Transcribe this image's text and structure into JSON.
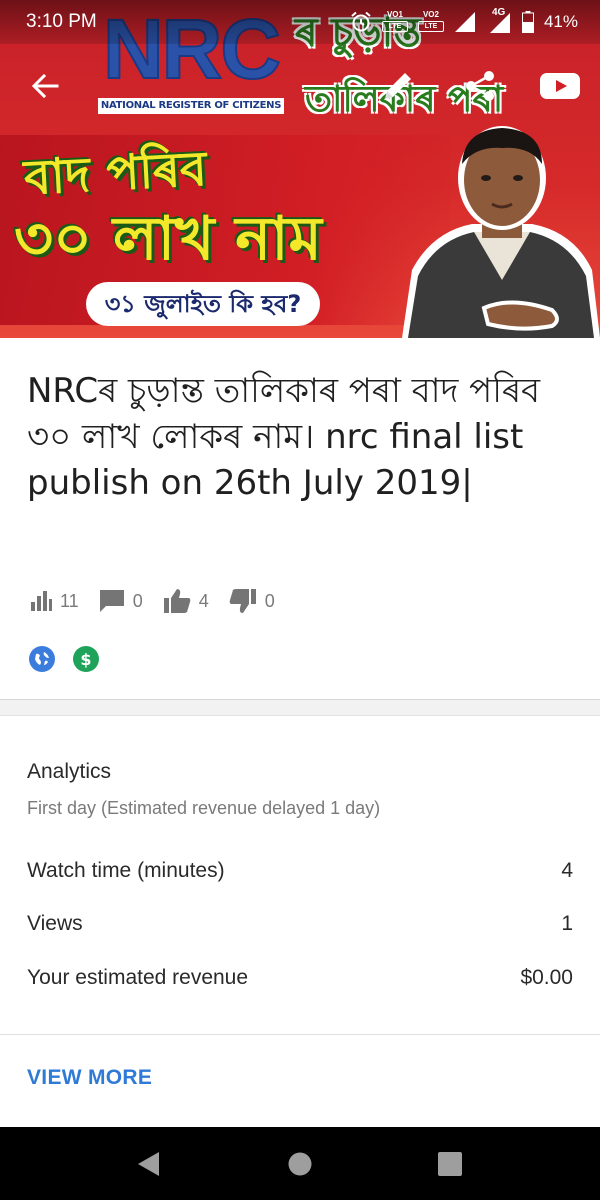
{
  "status_bar": {
    "time": "3:10 PM",
    "sim1_top": "VO",
    "sim1_num": "1",
    "sim1_box": "LTE",
    "sim2_top": "VO",
    "sim2_num": "2",
    "sim2_box": "LTE",
    "network": "4G",
    "battery": "41%"
  },
  "thumbnail": {
    "logo_text": "NRC",
    "logo_subtitle": "NATIONAL REGISTER OF CITIZENS",
    "headline_top": "ৰ চুড়ান্ত",
    "headline_mid": "তালিকাৰ পৰা",
    "big_line1": "বাদ পৰিব",
    "big_line2": "৩০ লাখ নাম",
    "question": "৩১ জুলাইত কি হব?"
  },
  "video": {
    "title": "NRCৰ চুড়ান্ত তালিকাৰ পৰা বাদ পৰিব ৩০ লাখ লোকৰ নাম। nrc final list publish on 26th July 2019|",
    "stats": {
      "views": "11",
      "comments": "0",
      "likes": "4",
      "dislikes": "0"
    }
  },
  "analytics": {
    "title": "Analytics",
    "subtitle": "First day (Estimated revenue delayed 1 day)",
    "metrics": [
      {
        "label": "Watch time (minutes)",
        "value": "4"
      },
      {
        "label": "Views",
        "value": "1"
      },
      {
        "label": "Your estimated revenue",
        "value": "$0.00"
      }
    ],
    "view_more": "VIEW MORE"
  },
  "colors": {
    "accent_link": "#2f7ad6",
    "public_badge": "#3b7ddd",
    "monetized_badge": "#1fa35a"
  },
  "icons": [
    "back-arrow-icon",
    "edit-pencil-icon",
    "share-icon",
    "youtube-icon",
    "bar-chart-icon",
    "comment-icon",
    "thumbs-up-icon",
    "thumbs-down-icon",
    "globe-icon",
    "dollar-icon",
    "nav-back-icon",
    "nav-home-icon",
    "nav-recents-icon"
  ]
}
